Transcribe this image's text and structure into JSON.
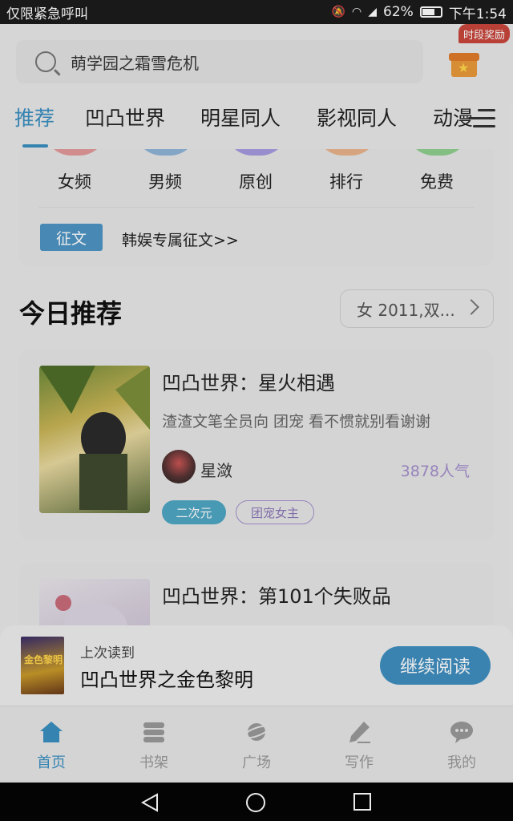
{
  "status_bar": {
    "carrier": "仅限紧急呼叫",
    "battery": "62%",
    "time": "下午1:54"
  },
  "search": {
    "placeholder": "萌学园之霜雪危机"
  },
  "reward_badge": "时段奖励",
  "tabs": [
    {
      "label": "推荐",
      "active": true
    },
    {
      "label": "凹凸世界",
      "active": false
    },
    {
      "label": "明星同人",
      "active": false
    },
    {
      "label": "影视同人",
      "active": false
    },
    {
      "label": "动漫",
      "active": false
    }
  ],
  "categories": [
    {
      "label": "女频",
      "color": "#e39a9a"
    },
    {
      "label": "男频",
      "color": "#8fb5d8"
    },
    {
      "label": "原创",
      "color": "#a59be0"
    },
    {
      "label": "排行",
      "color": "#e9b48a"
    },
    {
      "label": "免费",
      "color": "#8fcf8f"
    }
  ],
  "promo": {
    "tag": "征文",
    "text": "韩娱专属征文>>"
  },
  "today": {
    "title": "今日推荐",
    "filter": "女 2011,双..."
  },
  "books": [
    {
      "title": "凹凸世界：星火相遇",
      "desc": "渣渣文笔全员向 团宠 看不惯就别看谢谢",
      "author": "星潋",
      "popularity": "3878人气",
      "tags": [
        "二次元",
        "团宠女主"
      ]
    },
    {
      "title": "凹凸世界：第101个失败品"
    }
  ],
  "continue_reading": {
    "label": "上次读到",
    "title": "凹凸世界之金色黎明",
    "cover_text": "金色黎明",
    "button": "继续阅读"
  },
  "bottom_nav": [
    {
      "label": "首页",
      "icon": "home-icon",
      "active": true
    },
    {
      "label": "书架",
      "icon": "bookshelf-icon",
      "active": false
    },
    {
      "label": "广场",
      "icon": "planet-icon",
      "active": false
    },
    {
      "label": "写作",
      "icon": "pen-icon",
      "active": false
    },
    {
      "label": "我的",
      "icon": "chat-icon",
      "active": false
    }
  ],
  "colors": {
    "accent": "#3a8fc0",
    "popularity": "#a48fcc"
  }
}
